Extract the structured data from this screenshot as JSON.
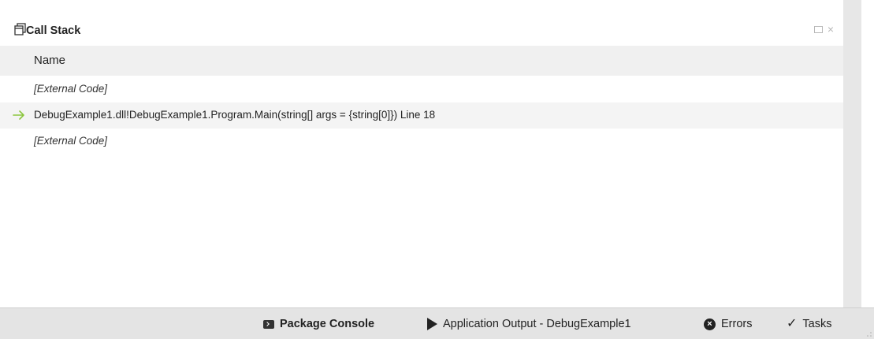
{
  "pad": {
    "title": "Call Stack",
    "column_header": "Name",
    "rows": [
      {
        "text": "[External Code]",
        "italic": true,
        "current": false
      },
      {
        "text": "DebugExample1.dll!DebugExample1.Program.Main(string[] args = {string[0]}) Line 18",
        "italic": false,
        "current": true
      },
      {
        "text": "[External Code]",
        "italic": true,
        "current": false
      }
    ],
    "controls": {
      "close_glyph": "×"
    }
  },
  "statusbar": {
    "package_console": "Package Console",
    "application_output": "Application Output - DebugExample1",
    "errors": "Errors",
    "tasks": "Tasks"
  },
  "colors": {
    "current_arrow": "#8cc63f",
    "header_bg": "#f0f0f0",
    "statusbar_bg": "#e4e4e4"
  },
  "icons": [
    "windows-stack-icon",
    "current-frame-arrow-icon",
    "maximize-icon",
    "close-icon",
    "terminal-icon",
    "play-icon",
    "error-icon",
    "checkmark-icon"
  ]
}
